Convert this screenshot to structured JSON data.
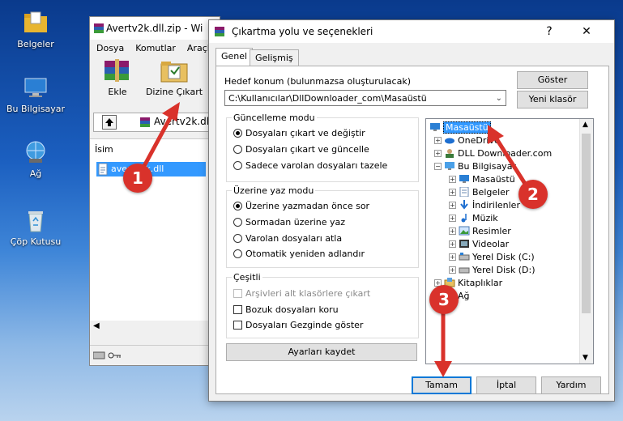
{
  "desktop": {
    "icons": [
      {
        "label": "Belgeler",
        "icon": "folder-icon"
      },
      {
        "label": "Bu Bilgisayar",
        "icon": "computer-icon"
      },
      {
        "label": "Ağ",
        "icon": "network-icon"
      },
      {
        "label": "Çöp Kutusu",
        "icon": "recycle-bin-icon"
      }
    ]
  },
  "rar_window": {
    "title": "Avertv2k.dll.zip - Wi",
    "menu": [
      "Dosya",
      "Komutlar",
      "Araçla"
    ],
    "toolbar": {
      "add": "Ekle",
      "extract": "Dizine Çıkart"
    },
    "address": "Avertv2k.dll",
    "column_name": "İsim",
    "file": "avertv2k.dll"
  },
  "dialog": {
    "title": "Çıkartma yolu ve seçenekleri",
    "help": "?",
    "close": "✕",
    "tabs": [
      "Genel",
      "Gelişmiş"
    ],
    "dest_label": "Hedef konum (bulunmazsa oluşturulacak)",
    "dest_value": "C:\\Kullanıcılar\\DllDownloader_com\\Masaüstü",
    "show_button": "Göster",
    "new_folder_button": "Yeni klasör",
    "update_group": {
      "caption": "Güncelleme modu",
      "options": [
        "Dosyaları çıkart ve değiştir",
        "Dosyaları çıkart ve güncelle",
        "Sadece varolan dosyaları tazele"
      ]
    },
    "overwrite_group": {
      "caption": "Üzerine yaz modu",
      "options": [
        "Üzerine yazmadan önce sor",
        "Sormadan üzerine yaz",
        "Varolan dosyaları atla",
        "Otomatik yeniden adlandır"
      ]
    },
    "misc_group": {
      "caption": "Çeşitli",
      "options": [
        "Arşivleri alt klasörlere çıkart",
        "Bozuk dosyaları koru",
        "Dosyaları Gezginde göster"
      ]
    },
    "save_settings": "Ayarları kaydet",
    "tree": [
      {
        "label": "Masaüstü",
        "icon": "desktop-icon"
      },
      {
        "label": "OneDrive",
        "icon": "cloud-icon"
      },
      {
        "label": "DLL Downloader.com",
        "icon": "user-icon"
      },
      {
        "label": "Bu Bilgisayar",
        "icon": "computer-icon"
      },
      {
        "label": "Masaüstü",
        "icon": "desktop-icon"
      },
      {
        "label": "Belgeler",
        "icon": "documents-icon"
      },
      {
        "label": "İndirilenler",
        "icon": "download-icon"
      },
      {
        "label": "Müzik",
        "icon": "music-icon"
      },
      {
        "label": "Resimler",
        "icon": "pictures-icon"
      },
      {
        "label": "Videolar",
        "icon": "videos-icon"
      },
      {
        "label": "Yerel Disk (C:)",
        "icon": "disk-icon"
      },
      {
        "label": "Yerel Disk (D:)",
        "icon": "disk-icon"
      },
      {
        "label": "Kitaplıklar",
        "icon": "libraries-icon"
      },
      {
        "label": "Ağ",
        "icon": "network-icon"
      }
    ],
    "buttons": {
      "ok": "Tamam",
      "cancel": "İptal",
      "help": "Yardım"
    }
  },
  "annotations": [
    "1",
    "2",
    "3"
  ],
  "colors": {
    "annotation": "#d9322b",
    "selection": "#3399ff"
  }
}
